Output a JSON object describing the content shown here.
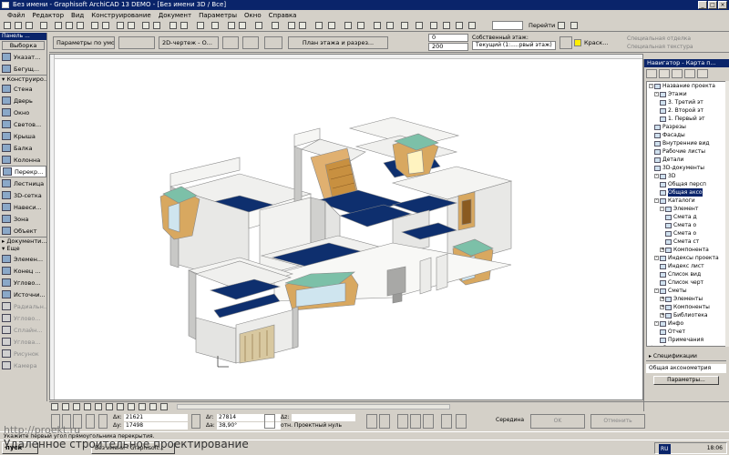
{
  "window": {
    "title": "Без имени - Graphisoft ArchiCAD 13 DEMO - [Без имени 3D / Все]",
    "controls": [
      "_",
      "□",
      "×"
    ]
  },
  "menu": [
    "Файл",
    "Редактор",
    "Вид",
    "Конструирование",
    "Документ",
    "Параметры",
    "Окно",
    "Справка"
  ],
  "toolbar": {
    "go_label": "Перейти"
  },
  "infobox": {
    "defaults_label": "Параметры по умолч.",
    "view_label": "2D-чертеж - О...",
    "floor_label": "План этажа и разрез...",
    "height_top": "0",
    "height_bottom": "200",
    "own_floor_label": "Собственный этаж:",
    "own_floor_value": "Текущий (1:.....рвый этаж)",
    "material_label": "Краск...",
    "special_1": "Специальная отделка",
    "special_2": "Специальная текстура"
  },
  "toolbox": {
    "title": "Панель ...",
    "select_label": "Выборка",
    "top_items": [
      {
        "name": "arrow",
        "label": "Указат..."
      },
      {
        "name": "marquee",
        "label": "Бегущ..."
      }
    ],
    "section_construct": "Конструиро...",
    "construct_items": [
      {
        "name": "wall",
        "label": "Стена"
      },
      {
        "name": "door",
        "label": "Дверь"
      },
      {
        "name": "window",
        "label": "Окно"
      },
      {
        "name": "skylight",
        "label": "Светов..."
      },
      {
        "name": "roof",
        "label": "Крыша"
      },
      {
        "name": "beam",
        "label": "Балка"
      },
      {
        "name": "column",
        "label": "Колонна"
      },
      {
        "name": "slab",
        "label": "Перекр..."
      },
      {
        "name": "stair",
        "label": "Лестница"
      },
      {
        "name": "mesh",
        "label": "3D-сетка"
      },
      {
        "name": "curtain",
        "label": "Навеси..."
      },
      {
        "name": "zone",
        "label": "Зона"
      },
      {
        "name": "object",
        "label": "Объект"
      }
    ],
    "section_document": "Документи...",
    "section_more": "Еще",
    "more_items": [
      {
        "name": "element",
        "label": "Элемен..."
      },
      {
        "name": "end",
        "label": "Конец ..."
      },
      {
        "name": "angle",
        "label": "Углово..."
      },
      {
        "name": "source",
        "label": "Источни..."
      }
    ],
    "disabled_items": [
      {
        "name": "radial",
        "label": "Радиальн..."
      },
      {
        "name": "angular",
        "label": "Углово..."
      },
      {
        "name": "spline",
        "label": "Сплайн..."
      },
      {
        "name": "angle2",
        "label": "Углова..."
      },
      {
        "name": "drawing",
        "label": "Рисунок"
      },
      {
        "name": "camera",
        "label": "Камера"
      }
    ],
    "active_item": "Перекр..."
  },
  "navigator": {
    "title": "Навигатор - Карта п...",
    "tree": [
      {
        "level": 0,
        "pm": "-",
        "label": "Название проекта"
      },
      {
        "level": 1,
        "pm": "-",
        "label": "Этажи"
      },
      {
        "level": 2,
        "pm": "",
        "label": "3. Третий эт"
      },
      {
        "level": 2,
        "pm": "",
        "label": "2. Второй эт"
      },
      {
        "level": 2,
        "pm": "",
        "label": "1. Первый эт"
      },
      {
        "level": 1,
        "pm": "",
        "label": "Разрезы"
      },
      {
        "level": 1,
        "pm": "",
        "label": "Фасады"
      },
      {
        "level": 1,
        "pm": "",
        "label": "Внутренние вид"
      },
      {
        "level": 1,
        "pm": "",
        "label": "Рабочие листы"
      },
      {
        "level": 1,
        "pm": "",
        "label": "Детали"
      },
      {
        "level": 1,
        "pm": "",
        "label": "3D-документы"
      },
      {
        "level": 1,
        "pm": "-",
        "label": "3D"
      },
      {
        "level": 2,
        "pm": "",
        "label": "Общая персп"
      },
      {
        "level": 2,
        "pm": "",
        "label": "Общая аксо",
        "selected": true
      },
      {
        "level": 1,
        "pm": "-",
        "label": "Каталоги"
      },
      {
        "level": 2,
        "pm": "-",
        "label": "Элемент"
      },
      {
        "level": 3,
        "pm": "",
        "label": "Смета д"
      },
      {
        "level": 3,
        "pm": "",
        "label": "Смета о"
      },
      {
        "level": 3,
        "pm": "",
        "label": "Смета о"
      },
      {
        "level": 3,
        "pm": "",
        "label": "Смета ст"
      },
      {
        "level": 2,
        "pm": "+",
        "label": "Компонента"
      },
      {
        "level": 1,
        "pm": "-",
        "label": "Индексы проекта"
      },
      {
        "level": 2,
        "pm": "",
        "label": "Индекс лист"
      },
      {
        "level": 2,
        "pm": "",
        "label": "Список вид"
      },
      {
        "level": 2,
        "pm": "",
        "label": "Список черт"
      },
      {
        "level": 1,
        "pm": "-",
        "label": "Сметы"
      },
      {
        "level": 2,
        "pm": "+",
        "label": "Элементы"
      },
      {
        "level": 2,
        "pm": "+",
        "label": "Компоненты"
      },
      {
        "level": 2,
        "pm": "+",
        "label": "Библиотека"
      },
      {
        "level": 1,
        "pm": "-",
        "label": "Инфо"
      },
      {
        "level": 2,
        "pm": "",
        "label": "Отчет"
      },
      {
        "level": 2,
        "pm": "",
        "label": "Примечания"
      },
      {
        "level": 0,
        "pm": "+",
        "label": "Справка"
      }
    ],
    "section_specs": "Спецификации",
    "current_view": "Общая аксонометрия",
    "params_button": "Параметры..."
  },
  "coords": {
    "dx_label": "Δx:",
    "dx_value": "21621",
    "dy_label": "Δy:",
    "dy_value": "17498",
    "da_label": "Δr:",
    "da_value": "27814",
    "angle_label": "Δa:",
    "angle_value": "38,90°",
    "dz_label": "Δz:",
    "dz_ref": "отн. Проектный нуль",
    "middle_label": "Середина",
    "ok_label": "OK",
    "cancel_label": "Отменить"
  },
  "status": {
    "text": "Укажите первый угол прямоугольника перекрытия."
  },
  "taskbar": {
    "start_label": "пуск",
    "task_label": "Без имени - Graphisoft...",
    "lang": "RU",
    "time": "18:06"
  },
  "watermark": {
    "line1": "http://proekt.ru",
    "line2": "Удаленное строительное проектирование"
  },
  "colors": {
    "titlebar": "#0a246a",
    "floor_blue": "#0e2f6e",
    "wall_white": "#f0f0ee",
    "wall_shade": "#c8c8c6",
    "glass": "#7cc0a8",
    "wood": "#d8a860"
  }
}
